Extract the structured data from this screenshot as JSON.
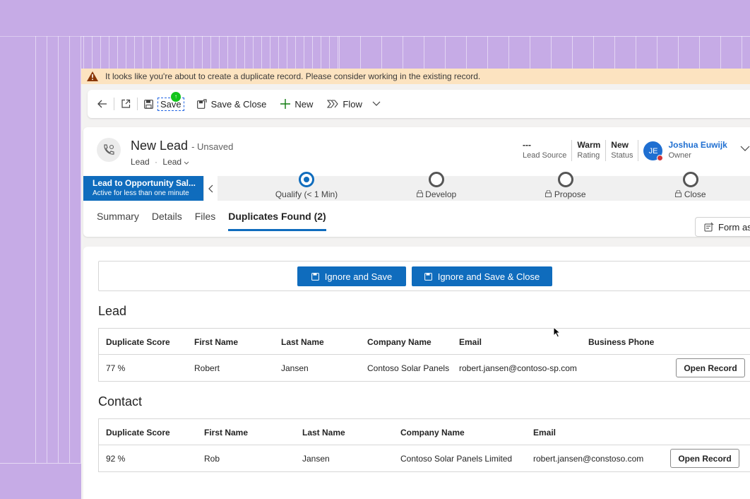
{
  "warning": {
    "text": "It looks like you're about to create a duplicate record. Please consider working in the existing record."
  },
  "toolbar": {
    "save_label": "Save",
    "save_badge": "↑",
    "save_close_label": "Save & Close",
    "new_label": "New",
    "flow_label": "Flow"
  },
  "header": {
    "title": "New Lead",
    "unsaved": "- Unsaved",
    "entity": "Lead",
    "form": "Lead",
    "fields": [
      {
        "value": "---",
        "label": "Lead Source"
      },
      {
        "value": "Warm",
        "label": "Rating"
      },
      {
        "value": "New",
        "label": "Status"
      }
    ],
    "owner": {
      "initials": "JE",
      "name": "Joshua Euwijk",
      "label": "Owner"
    }
  },
  "bpf": {
    "active_name": "Lead to Opportunity Sal...",
    "active_sub": "Active for less than one minute",
    "stages": [
      {
        "label": "Qualify  (< 1 Min)"
      },
      {
        "label": "Develop"
      },
      {
        "label": "Propose"
      },
      {
        "label": "Close"
      }
    ]
  },
  "tabs": [
    "Summary",
    "Details",
    "Files",
    "Duplicates Found (2)"
  ],
  "form_assist": "Form ass",
  "actions": {
    "ignore_save": "Ignore and Save",
    "ignore_save_close": "Ignore and Save & Close"
  },
  "lead_section": {
    "title": "Lead",
    "columns": [
      "Duplicate Score",
      "First Name",
      "Last Name",
      "Company Name",
      "Email",
      "Business Phone"
    ],
    "rows": [
      {
        "score": "77 %",
        "first": "Robert",
        "last": "Jansen",
        "company": "Contoso Solar Panels",
        "email": "robert.jansen@contoso-sp.com",
        "phone": "",
        "action": "Open Record"
      }
    ]
  },
  "contact_section": {
    "title": "Contact",
    "columns": [
      "Duplicate Score",
      "First Name",
      "Last Name",
      "Company Name",
      "Email"
    ],
    "rows": [
      {
        "score": "92 %",
        "first": "Rob",
        "last": "Jansen",
        "company": "Contoso Solar Panels Limited",
        "email": "robert.jansen@constoso.com",
        "action": "Open Record"
      }
    ]
  }
}
